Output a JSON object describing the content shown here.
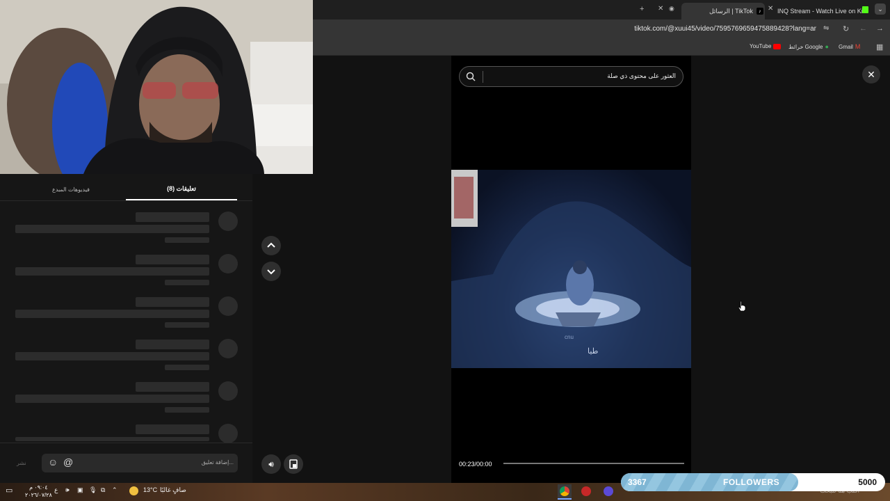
{
  "browser": {
    "tabs": [
      {
        "label": "INQ Stream - Watch Live on Kic"
      },
      {
        "label": "الرسائل | TikTok"
      }
    ],
    "url": "tiktok.com/@xuui45/video/7595769659475889428?lang=ar",
    "bookmarks": [
      {
        "label": "YouTube"
      },
      {
        "label": "خرائط Google"
      },
      {
        "label": "Gmail"
      }
    ]
  },
  "comments_panel": {
    "tabs": [
      {
        "label": "تعليقات (8)",
        "active": true
      },
      {
        "label": "فيديوهات المبدع",
        "active": false
      }
    ],
    "comment_input_placeholder": "إضافة تعليق...",
    "post_label": "نشر"
  },
  "video": {
    "search_placeholder": "العثور على محتوى ذي صلة",
    "time": "00:23/00:00",
    "progress": 0,
    "subtitle": "طيا",
    "watermark": "cnu"
  },
  "taskbar": {
    "weather_temp": "13°C",
    "weather_text": "صافٍ غالبًا",
    "time": "٠٩:٠٤ م",
    "date": "٢٠٢٦/٠٧/٢٨",
    "lang": "ع",
    "search_placeholder": "اكتب هنا للبحث"
  },
  "overlay": {
    "followers_current": "3367",
    "followers_label": "FOLLOWERS",
    "followers_goal": "5000",
    "followers_fraction": 0.67
  },
  "colors": {
    "progress_track": "#777777",
    "overlay_bar": "#7fb6d4"
  }
}
